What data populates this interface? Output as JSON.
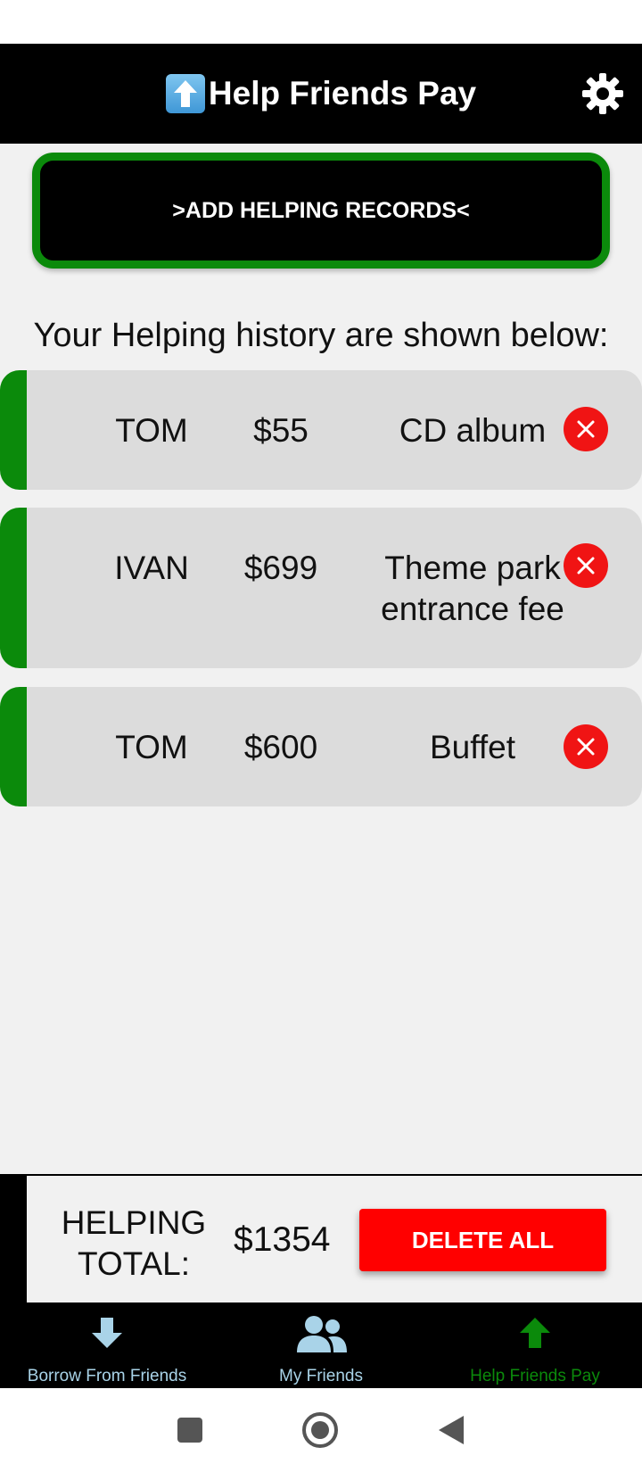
{
  "header": {
    "title": "Help Friends Pay",
    "emoji": "⬆️"
  },
  "add_button": {
    "label": ">ADD HELPING RECORDS<"
  },
  "history_label": "Your Helping history are shown below:",
  "records": [
    {
      "name": "TOM",
      "amount": "$55",
      "description": "CD album"
    },
    {
      "name": "IVAN",
      "amount": "$699",
      "description": "Theme park entrance fee"
    },
    {
      "name": "TOM",
      "amount": "$600",
      "description": "Buffet"
    }
  ],
  "total": {
    "label": "HELPING TOTAL:",
    "value": "$1354",
    "delete_all_label": "DELETE ALL"
  },
  "bottom_nav": {
    "items": [
      {
        "label": "Borrow From Friends",
        "icon": "arrow-down-icon",
        "active": false
      },
      {
        "label": "My Friends",
        "icon": "people-icon",
        "active": false
      },
      {
        "label": "Help Friends Pay",
        "icon": "arrow-up-icon",
        "active": true
      }
    ]
  },
  "colors": {
    "accent_green": "#0b8a0b",
    "delete_red": "#ff0000",
    "nav_inactive": "#a9d3e8",
    "nav_active": "#0b8a0b"
  }
}
